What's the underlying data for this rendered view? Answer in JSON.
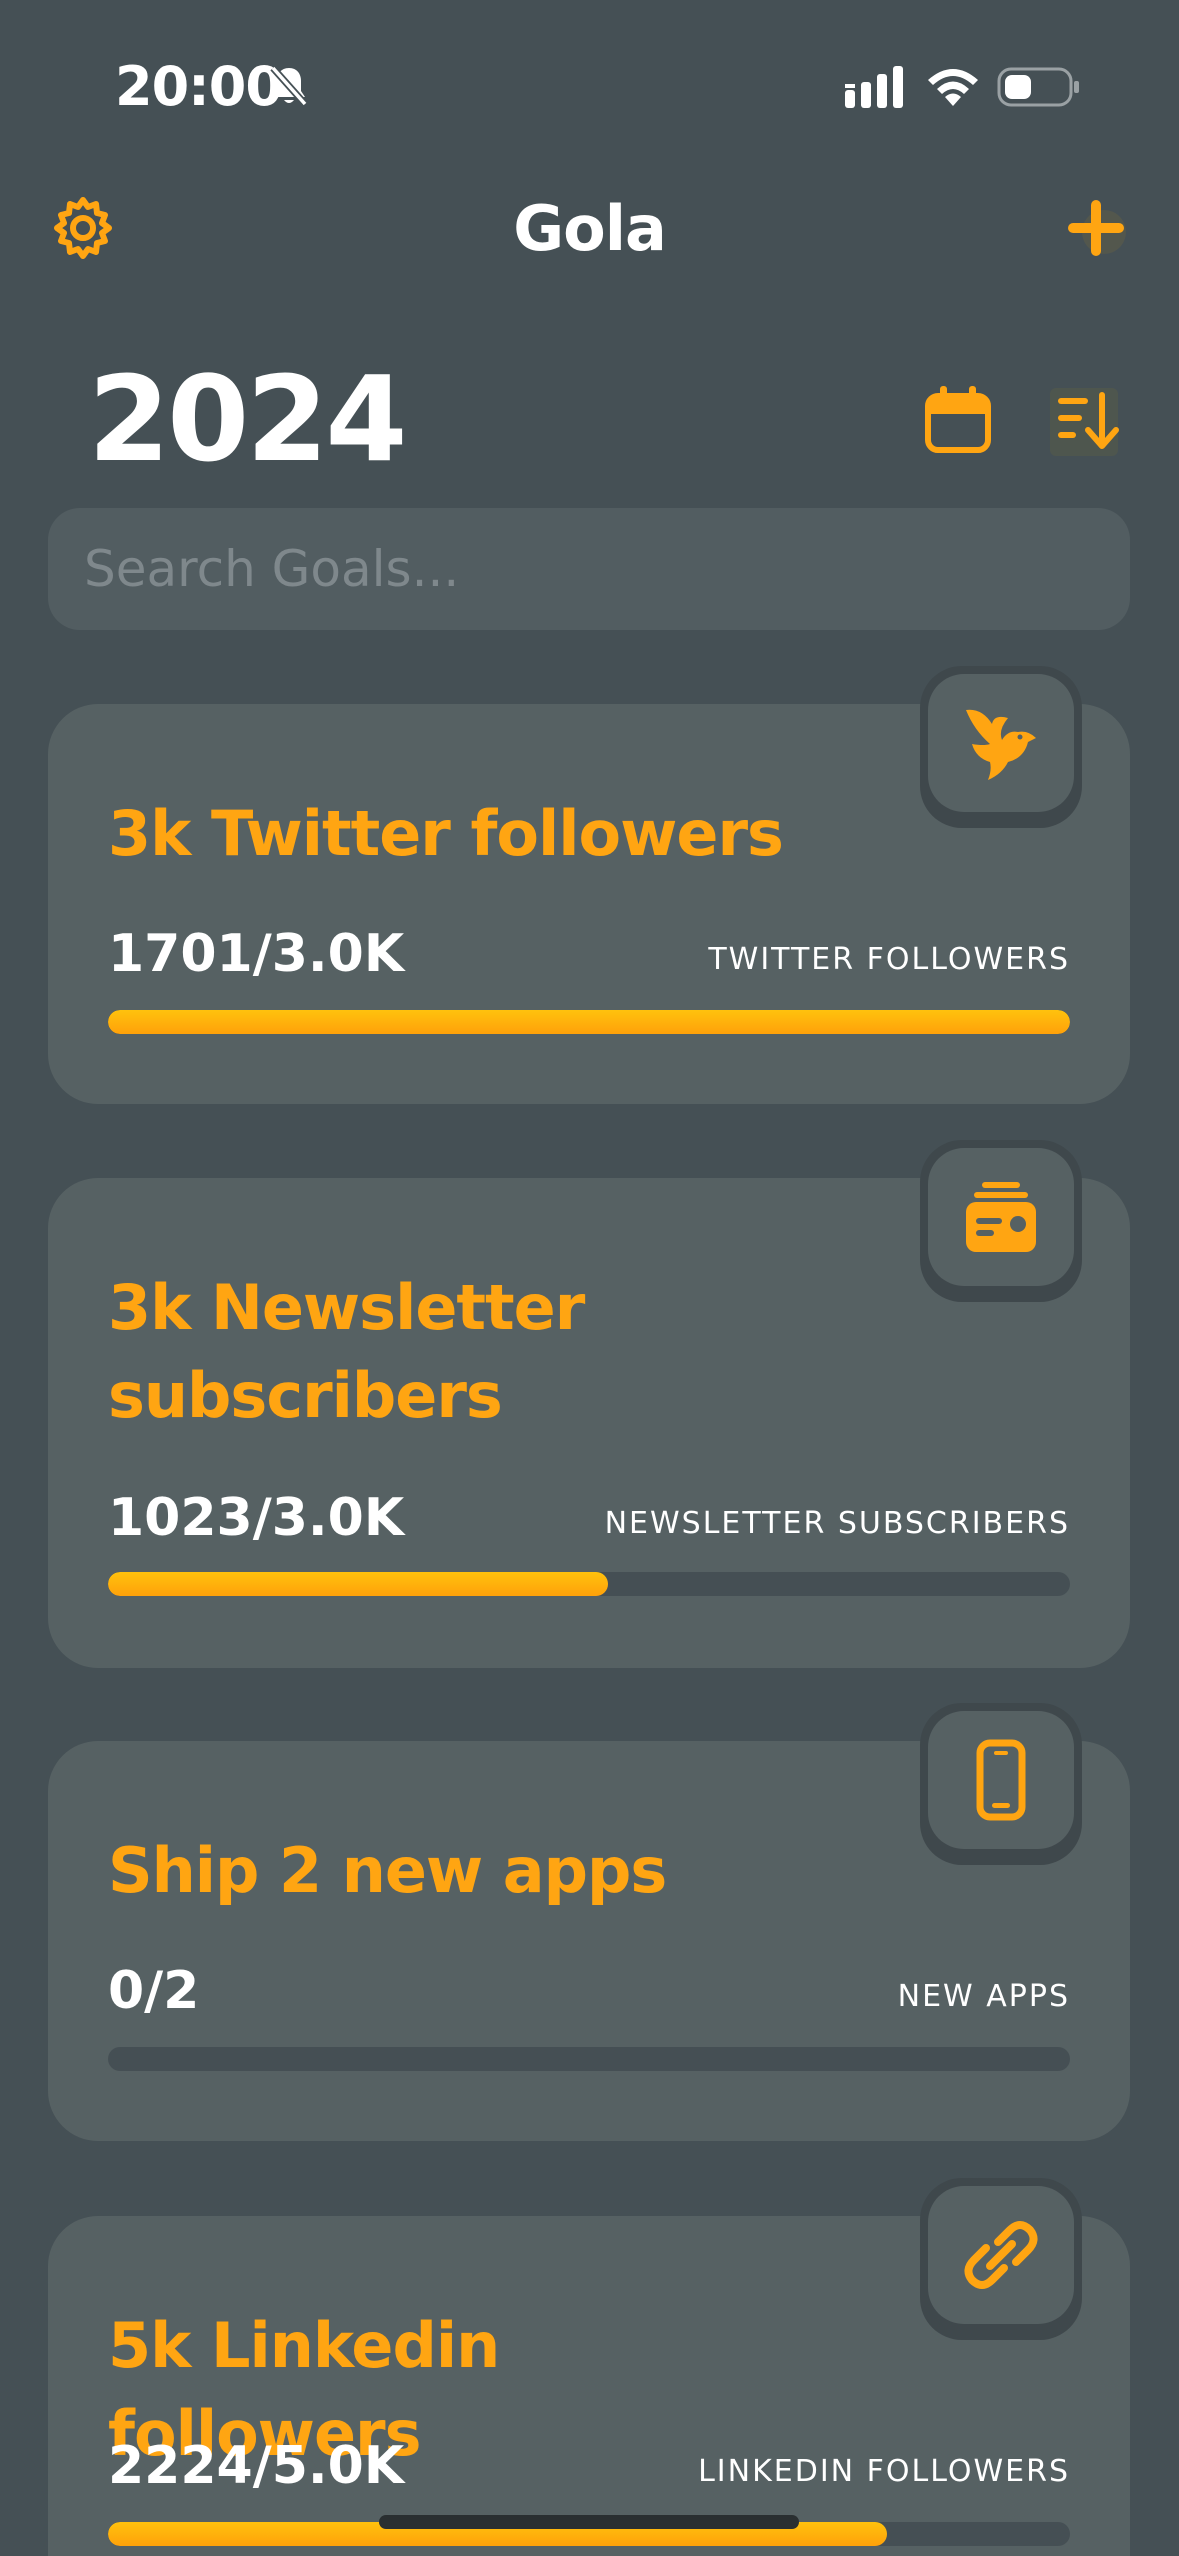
{
  "status_bar": {
    "time": "20:00"
  },
  "nav": {
    "title": "Gola"
  },
  "header": {
    "year": "2024"
  },
  "search": {
    "placeholder": "Search Goals..."
  },
  "colors": {
    "accent": "#ffa512",
    "background": "#455055",
    "card": "#566163",
    "track": "#454f54"
  },
  "goals": [
    {
      "title": "3k Twitter followers",
      "progress_text": "1701/3.0K",
      "metric_label": "TWITTER FOLLOWERS",
      "icon": "bird-icon",
      "progress_fraction": 1.0
    },
    {
      "title": "3k Newsletter subscribers",
      "progress_text": "1023/3.0K",
      "metric_label": "NEWSLETTER SUBSCRIBERS",
      "icon": "newsletter-icon",
      "progress_fraction": 0.52
    },
    {
      "title": "Ship 2 new apps",
      "progress_text": "0/2",
      "metric_label": "NEW APPS",
      "icon": "phone-icon",
      "progress_fraction": 0.0
    },
    {
      "title": "5k Linkedin followers",
      "progress_text": "2224/5.0K",
      "metric_label": "LINKEDIN FOLLOWERS",
      "icon": "link-icon",
      "progress_fraction": 0.81
    }
  ]
}
